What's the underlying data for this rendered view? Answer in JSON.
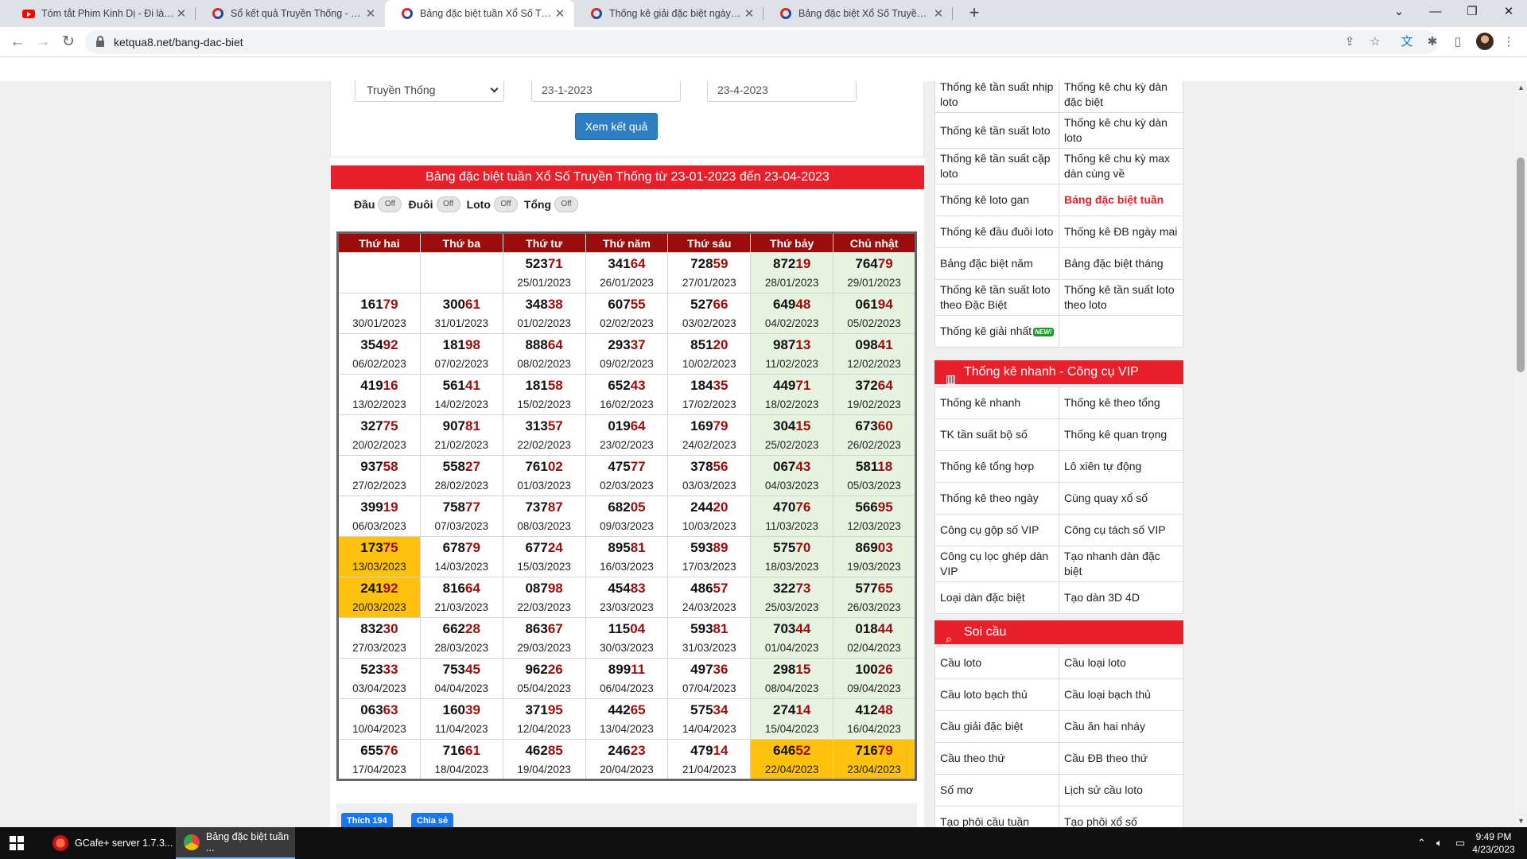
{
  "browser": {
    "tabs": [
      {
        "title": "Tóm tắt Phim Kinh Dị - Đi làm SẢ",
        "favicon": "youtube-icon",
        "active": false
      },
      {
        "title": "Sổ kết quả Truyền Thống - Tổng",
        "favicon": "ketqua-icon",
        "active": false
      },
      {
        "title": "Bảng đặc biệt tuần Xổ Số Truyền",
        "favicon": "ketqua-icon",
        "active": true
      },
      {
        "title": "Thống kê giải đặc biệt ngày hôm",
        "favicon": "ketqua-icon",
        "active": false
      },
      {
        "title": "Bảng đặc biệt Xổ Số Truyền Thống",
        "favicon": "ketqua-icon",
        "active": false
      }
    ],
    "url": "ketqua8.net/bang-dac-biet"
  },
  "form": {
    "select_value": "Truyền Thống",
    "date_from": "23-1-2023",
    "date_to": "23-4-2023",
    "submit_label": "Xem kết quả"
  },
  "table_title": "Bảng đặc biệt tuần Xổ Số Truyền Thống từ 23-01-2023 đến 23-04-2023",
  "toggles": [
    {
      "label": "Đầu",
      "state": "Off"
    },
    {
      "label": "Đuôi",
      "state": "Off"
    },
    {
      "label": "Loto",
      "state": "Off"
    },
    {
      "label": "Tổng",
      "state": "Off"
    }
  ],
  "weekdays": [
    "Thứ hai",
    "Thứ ba",
    "Thứ tư",
    "Thứ năm",
    "Thứ sáu",
    "Thứ bảy",
    "Chủ nhật"
  ],
  "weeks": [
    [
      null,
      null,
      [
        "52371",
        "25/01/2023"
      ],
      [
        "34164",
        "26/01/2023"
      ],
      [
        "72859",
        "27/01/2023"
      ],
      [
        "87219",
        "28/01/2023"
      ],
      [
        "76479",
        "29/01/2023"
      ]
    ],
    [
      [
        "16179",
        "30/01/2023"
      ],
      [
        "30061",
        "31/01/2023"
      ],
      [
        "34838",
        "01/02/2023"
      ],
      [
        "60755",
        "02/02/2023"
      ],
      [
        "52766",
        "03/02/2023"
      ],
      [
        "64948",
        "04/02/2023"
      ],
      [
        "06194",
        "05/02/2023"
      ]
    ],
    [
      [
        "35492",
        "06/02/2023"
      ],
      [
        "18198",
        "07/02/2023"
      ],
      [
        "88864",
        "08/02/2023"
      ],
      [
        "29337",
        "09/02/2023"
      ],
      [
        "85120",
        "10/02/2023"
      ],
      [
        "98713",
        "11/02/2023"
      ],
      [
        "09841",
        "12/02/2023"
      ]
    ],
    [
      [
        "41916",
        "13/02/2023"
      ],
      [
        "56141",
        "14/02/2023"
      ],
      [
        "18158",
        "15/02/2023"
      ],
      [
        "65243",
        "16/02/2023"
      ],
      [
        "18435",
        "17/02/2023"
      ],
      [
        "44971",
        "18/02/2023"
      ],
      [
        "37264",
        "19/02/2023"
      ]
    ],
    [
      [
        "32775",
        "20/02/2023"
      ],
      [
        "90781",
        "21/02/2023"
      ],
      [
        "31357",
        "22/02/2023"
      ],
      [
        "01964",
        "23/02/2023"
      ],
      [
        "16979",
        "24/02/2023"
      ],
      [
        "30415",
        "25/02/2023"
      ],
      [
        "67360",
        "26/02/2023"
      ]
    ],
    [
      [
        "93758",
        "27/02/2023"
      ],
      [
        "55827",
        "28/02/2023"
      ],
      [
        "76102",
        "01/03/2023"
      ],
      [
        "47577",
        "02/03/2023"
      ],
      [
        "37856",
        "03/03/2023"
      ],
      [
        "06743",
        "04/03/2023"
      ],
      [
        "58118",
        "05/03/2023"
      ]
    ],
    [
      [
        "39919",
        "06/03/2023"
      ],
      [
        "75877",
        "07/03/2023"
      ],
      [
        "73787",
        "08/03/2023"
      ],
      [
        "68205",
        "09/03/2023"
      ],
      [
        "24420",
        "10/03/2023"
      ],
      [
        "47076",
        "11/03/2023"
      ],
      [
        "56695",
        "12/03/2023"
      ]
    ],
    [
      [
        "17375",
        "13/03/2023"
      ],
      [
        "67879",
        "14/03/2023"
      ],
      [
        "67724",
        "15/03/2023"
      ],
      [
        "89581",
        "16/03/2023"
      ],
      [
        "59389",
        "17/03/2023"
      ],
      [
        "57570",
        "18/03/2023"
      ],
      [
        "86903",
        "19/03/2023"
      ]
    ],
    [
      [
        "24192",
        "20/03/2023"
      ],
      [
        "81664",
        "21/03/2023"
      ],
      [
        "08798",
        "22/03/2023"
      ],
      [
        "45483",
        "23/03/2023"
      ],
      [
        "48657",
        "24/03/2023"
      ],
      [
        "32273",
        "25/03/2023"
      ],
      [
        "57765",
        "26/03/2023"
      ]
    ],
    [
      [
        "83230",
        "27/03/2023"
      ],
      [
        "66228",
        "28/03/2023"
      ],
      [
        "86367",
        "29/03/2023"
      ],
      [
        "11504",
        "30/03/2023"
      ],
      [
        "59381",
        "31/03/2023"
      ],
      [
        "70344",
        "01/04/2023"
      ],
      [
        "01844",
        "02/04/2023"
      ]
    ],
    [
      [
        "52333",
        "03/04/2023"
      ],
      [
        "75345",
        "04/04/2023"
      ],
      [
        "96226",
        "05/04/2023"
      ],
      [
        "89911",
        "06/04/2023"
      ],
      [
        "49736",
        "07/04/2023"
      ],
      [
        "29815",
        "08/04/2023"
      ],
      [
        "10026",
        "09/04/2023"
      ]
    ],
    [
      [
        "06363",
        "10/04/2023"
      ],
      [
        "16039",
        "11/04/2023"
      ],
      [
        "37195",
        "12/04/2023"
      ],
      [
        "44265",
        "13/04/2023"
      ],
      [
        "57534",
        "14/04/2023"
      ],
      [
        "27414",
        "15/04/2023"
      ],
      [
        "41248",
        "16/04/2023"
      ]
    ],
    [
      [
        "65576",
        "17/04/2023"
      ],
      [
        "71661",
        "18/04/2023"
      ],
      [
        "46285",
        "19/04/2023"
      ],
      [
        "24623",
        "20/04/2023"
      ],
      [
        "47914",
        "21/04/2023"
      ],
      [
        "64652",
        "22/04/2023"
      ],
      [
        "71679",
        "23/04/2023"
      ]
    ]
  ],
  "highlighted_dates": [
    "13/03/2023",
    "20/03/2023",
    "22/04/2023",
    "23/04/2023"
  ],
  "colors": {
    "header_red": "#e8202c",
    "weekday_header": "#9b0c0c",
    "highlight": "#ffc20e",
    "weekend_bg": "#e6f3e0",
    "button_blue": "#2d7ec3"
  },
  "share": {
    "like_label": "Thích 194",
    "share_label": "Chia sẻ"
  },
  "sidebar": {
    "top_rows": [
      [
        "Thống kê tần suất nhịp loto",
        "Thống kê chu kỳ dàn đặc biệt"
      ],
      [
        "Thống kê tần suất loto",
        "Thống kê chu kỳ dàn loto"
      ],
      [
        "Thống kê tần suất cặp loto",
        "Thống kê chu kỳ max dàn cùng về"
      ],
      [
        "Thống kê loto gan",
        "Bảng đặc biệt tuần"
      ],
      [
        "Thống kê đầu đuôi loto",
        "Thống kê ĐB ngày mai"
      ],
      [
        "Bảng đặc biệt năm",
        "Bảng đặc biệt tháng"
      ],
      [
        "Thống kê tần suất loto theo Đặc Biệt",
        "Thống kê tần suất loto theo loto"
      ],
      [
        "Thống kê giải nhất",
        ""
      ]
    ],
    "new_badge": "NEW!",
    "vip_header": "Thống kê nhanh - Công cụ VIP",
    "vip_rows": [
      [
        "Thống kê nhanh",
        "Thống kê theo tổng"
      ],
      [
        "TK tần suất bộ số",
        "Thống kê quan trọng"
      ],
      [
        "Thống kê tổng hợp",
        "Lô xiên tự động"
      ],
      [
        "Thống kê theo ngày",
        "Cùng quay xổ số"
      ],
      [
        "Công cụ gộp số VIP",
        "Công cụ tách số VIP"
      ],
      [
        "Công cụ lọc ghép dàn VIP",
        "Tạo nhanh dàn đặc biệt"
      ],
      [
        "Loại dàn đặc biệt",
        "Tạo dàn 3D 4D"
      ]
    ],
    "soi_header": "Soi cầu",
    "soi_rows": [
      [
        "Cầu loto",
        "Cầu loại loto"
      ],
      [
        "Cầu loto bạch thủ",
        "Cầu loại bạch thủ"
      ],
      [
        "Cầu giải đặc biệt",
        "Cầu ăn hai nháy"
      ],
      [
        "Cầu theo thứ",
        "Cầu ĐB theo thứ"
      ],
      [
        "Số mơ",
        "Lịch sử cầu loto"
      ],
      [
        "Tạo phôi cầu tuần",
        "Tạo phôi xổ số"
      ]
    ]
  },
  "taskbar": {
    "apps": [
      {
        "label": "GCafe+ server 1.7.3...",
        "icon": "gcafe-icon"
      },
      {
        "label": "Bảng đặc biệt tuần ...",
        "icon": "chrome-icon"
      }
    ],
    "time": "9:49 PM",
    "date": "4/23/2023"
  }
}
